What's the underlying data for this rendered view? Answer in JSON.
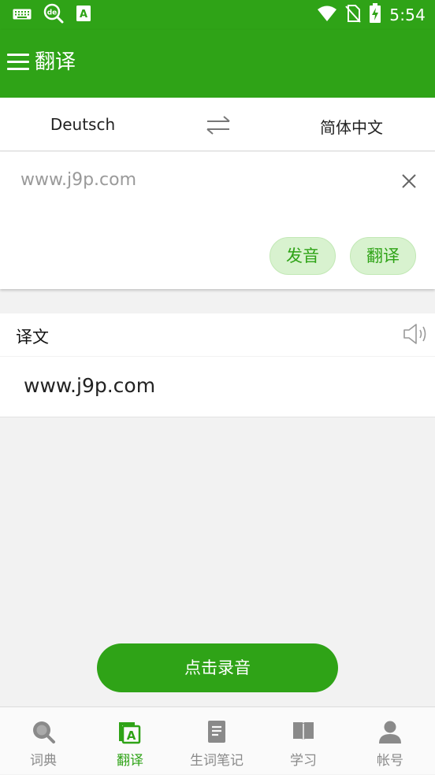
{
  "status_bar": {
    "time": "5:54",
    "icons": [
      "keyboard-icon",
      "de-dictionary-app-icon",
      "translate-app-icon",
      "wifi-icon",
      "no-sim-icon",
      "battery-charging-icon"
    ]
  },
  "app_bar": {
    "title": "翻译"
  },
  "languages": {
    "source": "Deutsch",
    "target": "简体中文"
  },
  "input": {
    "placeholder": "www.j9p.com",
    "value": ""
  },
  "buttons": {
    "pronounce": "发音",
    "translate": "翻译",
    "record": "点击录音"
  },
  "result": {
    "label": "译文",
    "text": "www.j9p.com"
  },
  "bottom_nav": {
    "items": [
      {
        "label": "词典",
        "icon": "search-icon",
        "active": false
      },
      {
        "label": "翻译",
        "icon": "translate-icon",
        "active": true
      },
      {
        "label": "生词笔记",
        "icon": "notes-icon",
        "active": false
      },
      {
        "label": "学习",
        "icon": "book-icon",
        "active": false
      },
      {
        "label": "帐号",
        "icon": "account-icon",
        "active": false
      }
    ]
  },
  "colors": {
    "primary": "#2fa317",
    "pill_bg": "#d8f2cf",
    "inactive": "#8a8a8a",
    "background": "#f2f2f2"
  }
}
